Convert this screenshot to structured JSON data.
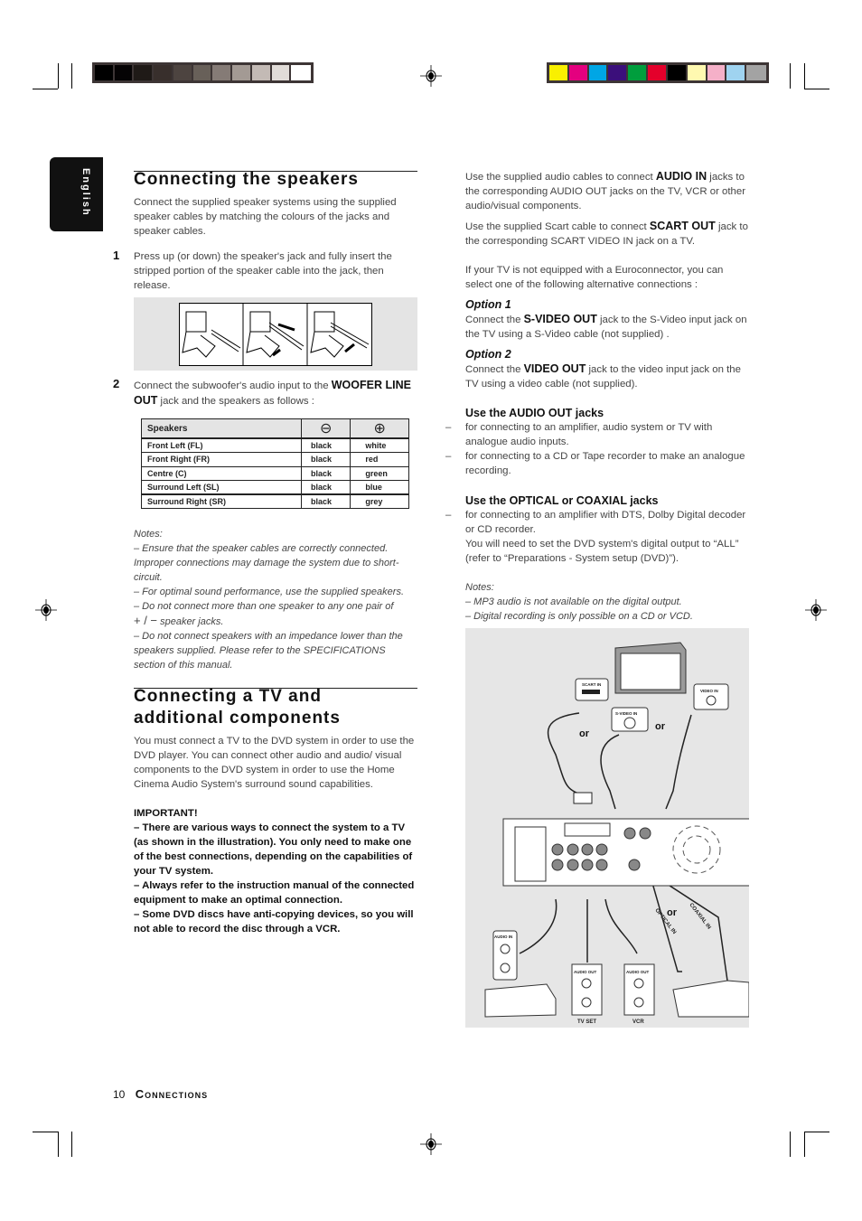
{
  "side_tab": "English",
  "print_marks": {
    "grayscale": [
      "#000000",
      "#050304",
      "#1f1a17",
      "#382f2c",
      "#4d4440",
      "#686059",
      "#857b76",
      "#a39a94",
      "#c3bab5",
      "#e1dcd8",
      "#ffffff"
    ],
    "colors": [
      "#f9f000",
      "#e4007f",
      "#00a6e5",
      "#3b0f7b",
      "#009e3d",
      "#e4002b",
      "#000000",
      "#fff9b0",
      "#f5b0c8",
      "#9fd3f0",
      "#a3a3a3"
    ]
  },
  "left": {
    "title": "Connecting the speakers",
    "intro": "Connect the supplied speaker systems using the supplied speaker cables by matching the colours of the jacks and speaker cables.",
    "step1_num": "1",
    "step1": "Press up (or down) the speaker's jack and fully insert the stripped portion of the speaker cable into the jack, then release.",
    "step2_num": "2",
    "step2_pre": "Connect the subwoofer's audio input to the ",
    "step2_bold": "WOOFER LINE OUT",
    "step2_post": " jack and the speakers as follows :",
    "table": {
      "headers": [
        "Speakers",
        "⊖",
        "⊕"
      ],
      "rows": [
        [
          "Front Left (FL)",
          "black",
          "white"
        ],
        [
          "Front Right (FR)",
          "black",
          "red"
        ],
        [
          "Centre (C)",
          "black",
          "green"
        ],
        [
          "Surround Left (SL)",
          "black",
          "blue"
        ],
        [
          "Surround Right (SR)",
          "black",
          "grey"
        ]
      ]
    },
    "notes_title": "Notes:",
    "notes": [
      "–  Ensure that the speaker cables are correctly connected. Improper connections may damage the system due to short-circuit.",
      "–  For optimal sound performance, use the supplied speakers.",
      "–  Do not connect more than one speaker to any one pair of",
      "+ / −",
      " speaker jacks.",
      "–  Do not connect speakers with an impedance lower than the speakers supplied.  Please refer to the SPECIFICATIONS section of this manual."
    ],
    "title2": "Connecting a TV and additional components",
    "intro2": "You must connect a TV to the DVD system in order to use the DVD player. You can connect other audio and audio/ visual components to the DVD system in order to use the Home Cinema Audio System's surround sound capabilities.",
    "important_title": "IMPORTANT!",
    "important": [
      "–  There are various ways to connect the system to a TV (as shown in the illustration). You only need to make one of the best connections, depending on the capabilities of your TV system.",
      "–  Always refer to the instruction manual of the connected equipment to make an optimal connection.",
      "–  Some DVD discs have anti-copying devices, so you will not able to record the disc through a VCR."
    ]
  },
  "right": {
    "p1_pre": "Use the supplied audio cables to connect ",
    "p1_bold": "AUDIO IN",
    "p1_post": " jacks to the corresponding AUDIO OUT jacks on the TV, VCR or other audio/visual components.",
    "p2_pre": "Use the supplied Scart cable to connect ",
    "p2_bold": "SCART OUT",
    "p2_post": " jack to the corresponding SCART VIDEO IN jack on a TV.",
    "p3": "If your TV is not equipped with a Euroconnector, you can select one of the following alternative connections :",
    "opt1_title": "Option 1",
    "opt1_pre": "Connect the ",
    "opt1_bold": "S-VIDEO OUT",
    "opt1_post": " jack to the S-Video input jack on the TV using a S-Video cable (not supplied) .",
    "opt2_title": "Option 2",
    "opt2_pre": "Connect the ",
    "opt2_bold": "VIDEO OUT",
    "opt2_post": " jack to the video input jack on the TV using a video cable (not supplied).",
    "audio_out_title": "Use the AUDIO OUT jacks",
    "audio_out_items": [
      "for connecting to an amplifier, audio system or TV with analogue audio inputs.",
      "for connecting to a CD or Tape recorder to make an analogue recording."
    ],
    "optical_title": "Use the OPTICAL or COAXIAL jacks",
    "optical_item": "for connecting to an amplifier with DTS, Dolby Digital decoder or CD recorder.",
    "optical_note": "You will need to set the DVD system's digital output to “ALL” (refer to “Preparations - System setup (DVD)”).",
    "notes_title": "Notes:",
    "notes": [
      "–  MP3 audio is not available on the digital output.",
      "–  Digital recording is only possible on a CD or VCD."
    ],
    "diagram": {
      "scart_in": "SCART IN",
      "svideo_in": "S-VIDEO IN",
      "video_in": "VIDEO IN",
      "or": "or",
      "audio_in": "AUDIO IN",
      "audio_out": "AUDIO OUT",
      "tv_set": "TV SET",
      "vcr": "VCR",
      "optical_in": "OPTICAL IN",
      "coaxial_in": "COAXIAL IN"
    }
  },
  "footer": {
    "page": "10",
    "section": "Connections"
  }
}
